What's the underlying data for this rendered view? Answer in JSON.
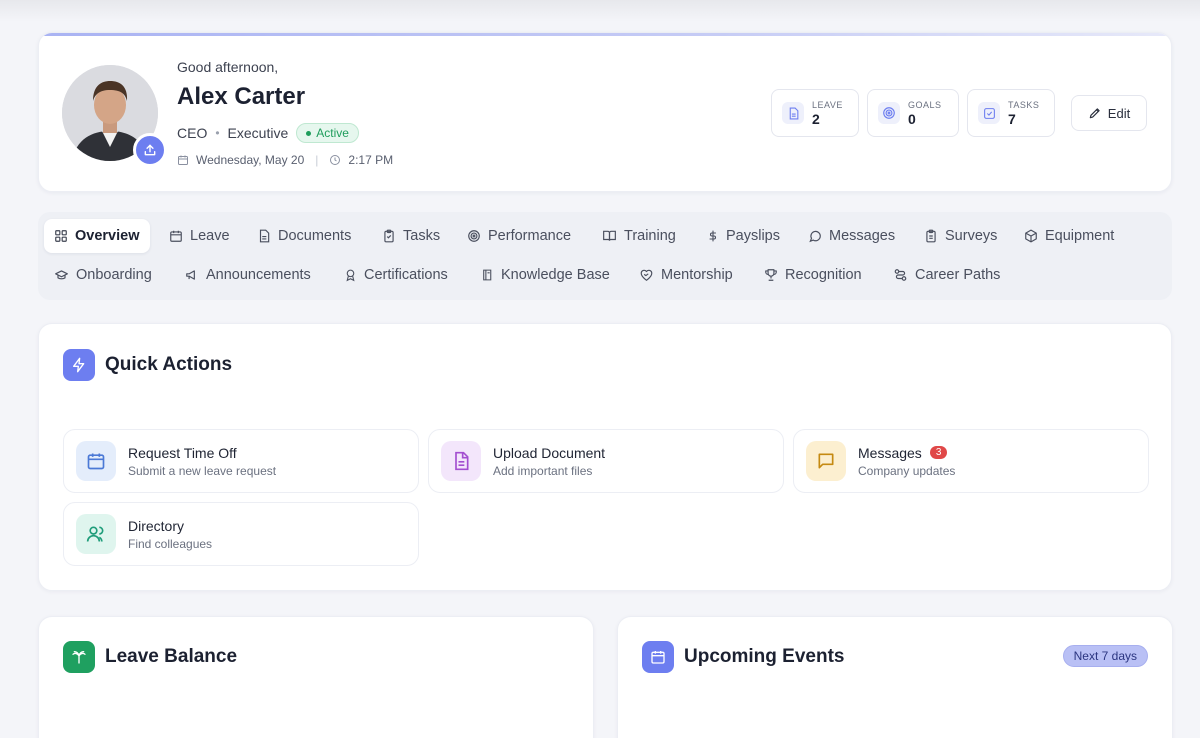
{
  "header": {
    "greeting": "Good afternoon,",
    "name": "Alex Carter",
    "role": "CEO",
    "department": "Executive",
    "status": "Active",
    "date": "Wednesday, May 20",
    "time": "2:17 PM",
    "edit_label": "Edit"
  },
  "stats": [
    {
      "label": "LEAVE",
      "value": "2",
      "icon": "document-icon"
    },
    {
      "label": "GOALS",
      "value": "0",
      "icon": "target-icon"
    },
    {
      "label": "TASKS",
      "value": "7",
      "icon": "checkbox-icon"
    }
  ],
  "tabs": {
    "row1": [
      {
        "label": "Overview",
        "icon": "grid-icon",
        "active": true
      },
      {
        "label": "Leave",
        "icon": "calendar-icon"
      },
      {
        "label": "Documents",
        "icon": "document-icon"
      },
      {
        "label": "Tasks",
        "icon": "clipboard-check-icon"
      },
      {
        "label": "Performance",
        "icon": "target-icon"
      },
      {
        "label": "Training",
        "icon": "book-icon"
      },
      {
        "label": "Payslips",
        "icon": "dollar-icon"
      },
      {
        "label": "Messages",
        "icon": "chat-icon"
      },
      {
        "label": "Surveys",
        "icon": "clipboard-icon"
      },
      {
        "label": "Equipment",
        "icon": "box-icon"
      }
    ],
    "row2": [
      {
        "label": "Onboarding",
        "icon": "graduation-cap-icon"
      },
      {
        "label": "Announcements",
        "icon": "megaphone-icon"
      },
      {
        "label": "Certifications",
        "icon": "award-icon"
      },
      {
        "label": "Knowledge Base",
        "icon": "book-icon"
      },
      {
        "label": "Mentorship",
        "icon": "heart-handshake-icon"
      },
      {
        "label": "Recognition",
        "icon": "trophy-icon"
      },
      {
        "label": "Career Paths",
        "icon": "route-icon"
      }
    ]
  },
  "quick_actions": {
    "title": "Quick Actions",
    "items": [
      {
        "title": "Request Time Off",
        "subtitle": "Submit a new leave request",
        "icon": "calendar-icon",
        "color": "#e4edfb"
      },
      {
        "title": "Upload Document",
        "subtitle": "Add important files",
        "icon": "file-text-icon",
        "color": "#f3e6fb"
      },
      {
        "title": "Messages",
        "subtitle": "Company updates",
        "icon": "chat-icon",
        "color": "#fcefd0",
        "badge": "3"
      },
      {
        "title": "Directory",
        "subtitle": "Find colleagues",
        "icon": "users-icon",
        "color": "#dff5ee"
      }
    ]
  },
  "leave_balance": {
    "title": "Leave Balance"
  },
  "upcoming_events": {
    "title": "Upcoming Events",
    "range_label": "Next 7 days"
  },
  "colors": {
    "accent": "#6d7ef0",
    "active_green": "#1f9d5c",
    "badge_red": "#e04848",
    "leave_green": "#1fa060"
  }
}
